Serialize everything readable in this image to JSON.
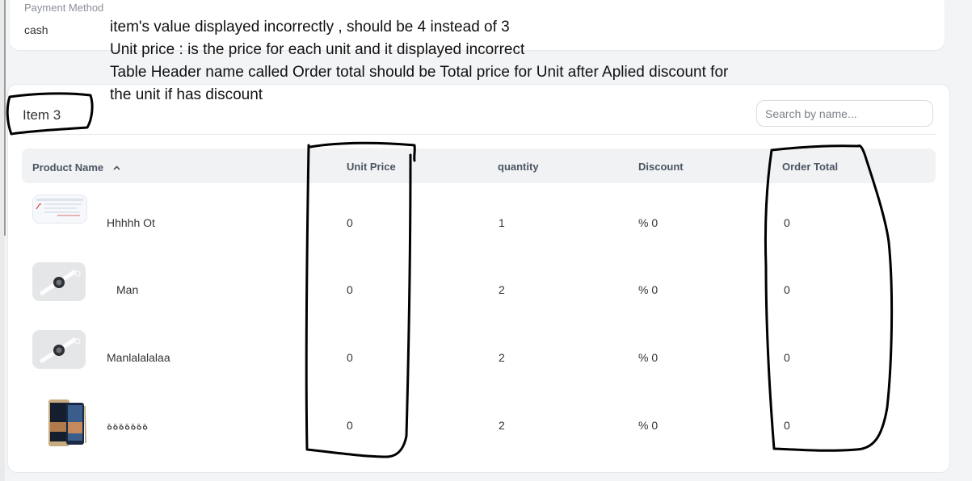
{
  "payment": {
    "label": "Payment Method",
    "value": "cash"
  },
  "annotation": {
    "lines": [
      "item's value displayed incorrectly , should be 4 instead of 3",
      "Unit price :  is the price for each unit and it displayed incorrect",
      "Table Header name called Order total should be Total price for Unit after Aplied discount for",
      "the unit if has discount"
    ]
  },
  "items": {
    "title": "Item 3",
    "search_placeholder": "Search by name...",
    "columns": {
      "product_name": "Product Name",
      "unit_price": "Unit Price",
      "quantity": "quantity",
      "discount": "Discount",
      "order_total": "Order Total"
    },
    "sort_icon": "chevron-up-icon",
    "rows": [
      {
        "name": "Hhhhh Ot",
        "unit_price": "0",
        "quantity": "1",
        "discount": "% 0",
        "order_total": "0",
        "thumb": "screenshot-thumbnail"
      },
      {
        "name": "Man",
        "unit_price": "0",
        "quantity": "2",
        "discount": "% 0",
        "order_total": "0",
        "thumb": "smartwatch-thumbnail"
      },
      {
        "name": "Manlalalalaa",
        "unit_price": "0",
        "quantity": "2",
        "discount": "% 0",
        "order_total": "0",
        "thumb": "smartwatch-thumbnail"
      },
      {
        "name": "ةةةةةةة",
        "unit_price": "0",
        "quantity": "2",
        "discount": "% 0",
        "order_total": "0",
        "thumb": "phone-thumbnail"
      }
    ]
  },
  "colors": {
    "ink": "#000000",
    "header_bg": "#f1f2f4",
    "card_bg": "#ffffff",
    "page_bg": "#f3f4f6"
  }
}
